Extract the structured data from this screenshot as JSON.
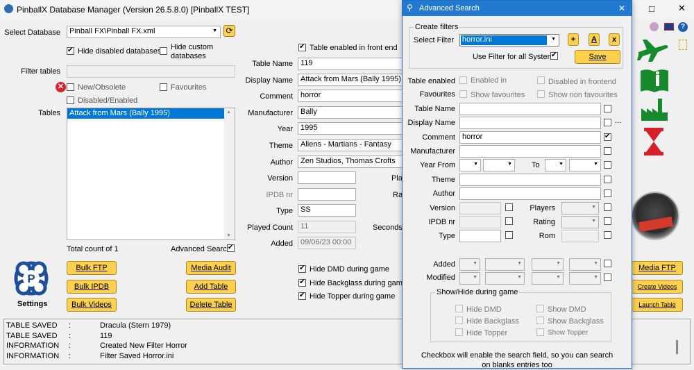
{
  "titlebar": {
    "title": "PinballX Database Manager (Version 26.5.8.0)   [PinballX TEST]",
    "controls": [
      "–",
      "□",
      "✕"
    ]
  },
  "left": {
    "select_db_label": "Select Database",
    "select_db_value": "Pinball FX\\Pinball FX.xml",
    "hide_disabled": "Hide disabled databases",
    "hide_custom": "Hide custom databases",
    "filter_tables_label": "Filter tables",
    "new_obsolete": "New/Obsolete",
    "favourites": "Favourites",
    "disabled_enabled": "Disabled/Enabled",
    "tables_label": "Tables",
    "tables": [
      "Attack from Mars (Bally 1995)"
    ],
    "total_count": "Total count of 1",
    "advanced_search": "Advanced Search",
    "settings": "Settings",
    "buttons": {
      "bulk_ftp": "Bulk FTP",
      "bulk_ipdb": "Bulk IPDB",
      "bulk_videos": "Bulk Videos",
      "media_audit": "Media Audit",
      "add_table": "Add Table",
      "delete_table": "Delete Table"
    }
  },
  "detail": {
    "table_enabled": "Table enabled in front end",
    "table_name_label": "Table Name",
    "table_name": "119",
    "display_name_label": "Display Name",
    "display_name": "Attack from Mars (Bally 1995)",
    "comment_label": "Comment",
    "comment": "horror",
    "manufacturer_label": "Manufacturer",
    "manufacturer": "Bally",
    "year_label": "Year",
    "year": "1995",
    "theme_label": "Theme",
    "theme": "Aliens - Martians - Fantasy",
    "author_label": "Author",
    "author": "Zen Studios,  Thomas Crofts",
    "version_label": "Version",
    "version": "",
    "ipdb_label": "IPDB nr",
    "ipdb": "",
    "type_label": "Type",
    "type": "SS",
    "played_label": "Played Count",
    "played": "11",
    "seconds_label": "Seconds",
    "added_label": "Added",
    "added": "09/06/23 00:00",
    "pla_frag": "Pla",
    "ra_frag": "Ra",
    "hide_dmd": "Hide DMD during game",
    "hide_backglass": "Hide Backglass during game",
    "hide_topper": "Hide Topper during game"
  },
  "right_buttons": {
    "media_ftp": "Media FTP",
    "create_videos": "Create Videos",
    "launch_table": "Launch Table"
  },
  "log": [
    {
      "a": "TABLE SAVED",
      "b": ":",
      "c": "Dracula (Stern 1979)"
    },
    {
      "a": "TABLE SAVED",
      "b": ":",
      "c": "119"
    },
    {
      "a": "INFORMATION",
      "b": ":",
      "c": "Created New Filter Horror"
    },
    {
      "a": "INFORMATION",
      "b": ":",
      "c": "Filter Saved Horror.ini"
    }
  ],
  "dialog": {
    "title": "Advanced Search",
    "close": "✕",
    "create_filters": "Create filters",
    "select_filter_label": "Select Filter",
    "select_filter_value": "horror.ini",
    "use_filter": "Use Filter for all Systems",
    "save": "Save",
    "btn_plus": "+",
    "btn_az": "A",
    "btn_x": "x",
    "table_enabled_label": "Table enabled",
    "enabled_in": "Enabled in",
    "disabled_in": "Disabled in frontend",
    "favourites_label": "Favourites",
    "show_fav": "Show favourites",
    "show_nonfav": "Show non favourites",
    "table_name_label": "Table Name",
    "display_name_label": "Display Name",
    "ellipsis": "...",
    "comment_label": "Comment",
    "comment_value": "horror",
    "manufacturer_label": "Manufacturer",
    "year_from_label": "Year From",
    "to_label": "To",
    "theme_label": "Theme",
    "author_label": "Author",
    "version_label": "Version",
    "players_label": "Players",
    "ipdb_label": "IPDB nr",
    "rating_label": "Rating",
    "type_label": "Type",
    "rom_label": "Rom",
    "added_label": "Added",
    "modified_label": "Modified",
    "showhide_title": "Show/Hide during game",
    "hide_dmd": "Hide DMD",
    "show_dmd": "Show DMD",
    "hide_backglass": "Hide Backglass",
    "show_backglass": "Show Backglass",
    "hide_topper": "Hide Topper",
    "show_topper": "Show Topper",
    "footer": "Checkbox will enable the search field, so you can search on blanks entries too"
  }
}
